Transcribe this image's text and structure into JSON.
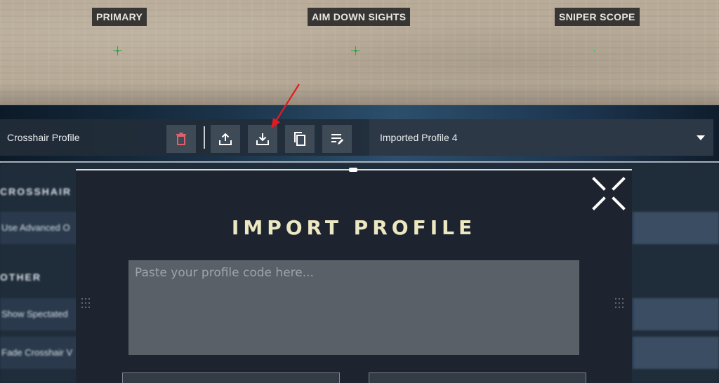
{
  "preview": {
    "labels": [
      "PRIMARY",
      "AIM DOWN SIGHTS",
      "SNIPER SCOPE"
    ]
  },
  "profile_bar": {
    "title": "Crosshair Profile",
    "buttons": [
      "delete-icon",
      "upload-icon",
      "download-icon",
      "copy-icon",
      "rename-icon"
    ],
    "selected_profile": "Imported Profile 4"
  },
  "settings": {
    "headers": [
      "CROSSHAIR",
      "OTHER"
    ],
    "rows": [
      "Use Advanced O",
      "Show Spectated",
      "Fade Crosshair V"
    ]
  },
  "modal": {
    "title": "IMPORT PROFILE",
    "input_placeholder": "Paste your profile code here..."
  },
  "colors": {
    "accent_title": "#ece8c2",
    "annotation_arrow": "#e11b22",
    "crosshair": "#2fa54a"
  }
}
